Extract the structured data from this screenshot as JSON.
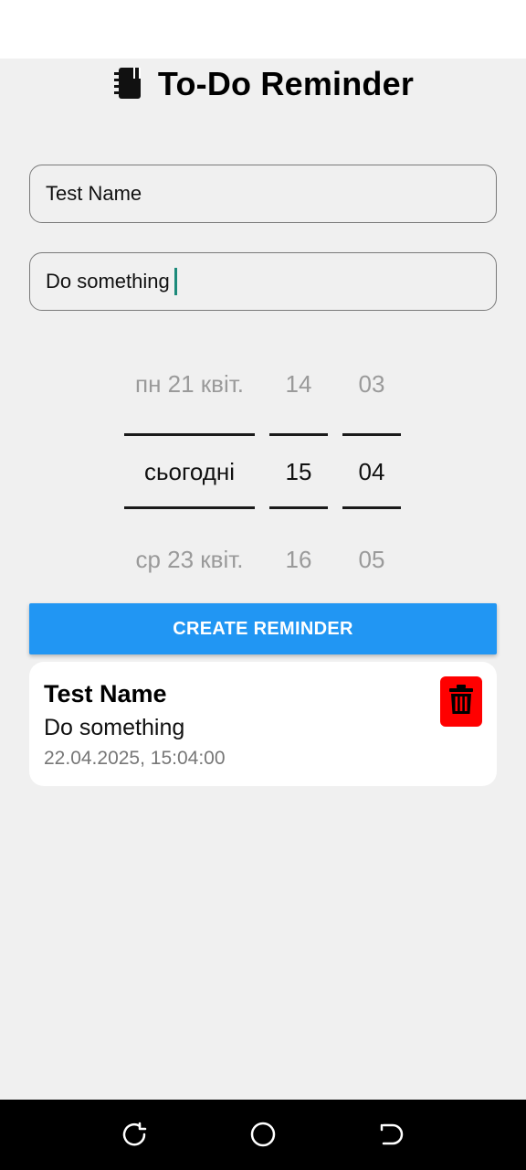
{
  "app": {
    "title": "To-Do Reminder",
    "logo_icon": "notebook-icon"
  },
  "form": {
    "name_value": "Test Name",
    "description_value": "Do something"
  },
  "picker": {
    "date": [
      "пн 21 квіт.",
      "сьогодні",
      "ср 23 квіт."
    ],
    "hour": [
      "14",
      "15",
      "16"
    ],
    "minute": [
      "03",
      "04",
      "05"
    ]
  },
  "create_button": {
    "label": "CREATE REMINDER",
    "color": "#2196f3"
  },
  "reminders": [
    {
      "title": "Test Name",
      "description": "Do something",
      "datetime": "22.04.2025, 15:04:00",
      "delete_icon": "trash-icon",
      "delete_color": "#ff0000"
    }
  ],
  "navbar": {
    "icons": [
      "recent-apps-icon",
      "home-icon",
      "back-icon"
    ]
  }
}
